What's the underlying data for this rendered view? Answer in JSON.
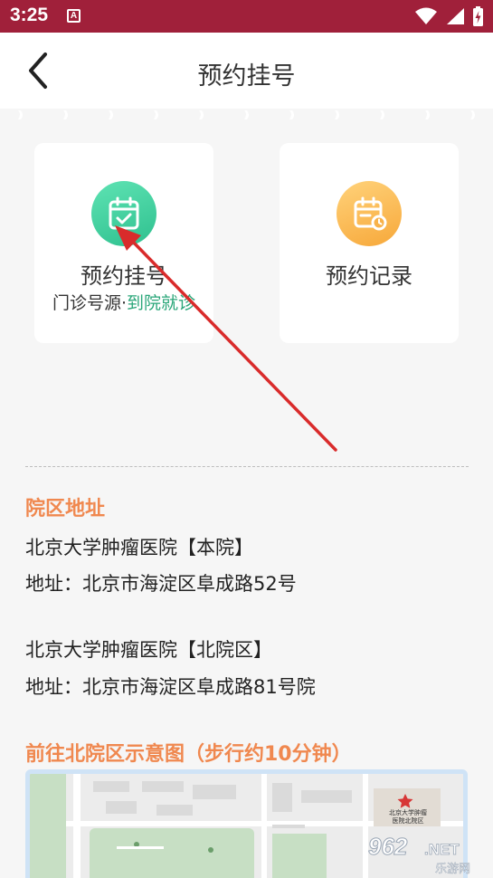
{
  "status_bar": {
    "time": "3:25",
    "notification_letter": "A",
    "icons": [
      "wifi-icon",
      "signal-icon",
      "battery-charging-icon"
    ]
  },
  "header": {
    "title": "预约挂号",
    "back_icon": "chevron-left-icon"
  },
  "cards": [
    {
      "title": "预约挂号",
      "subtitle_prefix": "门诊号源·",
      "subtitle_highlight": "到院就诊",
      "icon": "calendar-check-icon",
      "color": "#34c996"
    },
    {
      "title": "预约记录",
      "icon": "calendar-clock-icon",
      "color": "#f8b24a"
    }
  ],
  "address_section": {
    "heading": "院区地址",
    "campuses": [
      {
        "name": "北京大学肿瘤医院【本院】",
        "address": "地址：北京市海淀区阜成路52号"
      },
      {
        "name": "北京大学肿瘤医院【北院区】",
        "address": "地址：北京市海淀区阜成路81号院"
      }
    ]
  },
  "map_section": {
    "heading": "前往北院区示意图（步行约10分钟）",
    "map_labels": [
      "北京大学肿瘤",
      "医院北院区"
    ]
  },
  "watermark": {
    "brand": "962",
    "suffix": ".NET",
    "caption": "乐游网"
  },
  "colors": {
    "status_bar": "#a0203a",
    "accent_orange": "#f0884f",
    "highlight_green": "#2aa679",
    "arrow_red": "#d92b2b"
  }
}
